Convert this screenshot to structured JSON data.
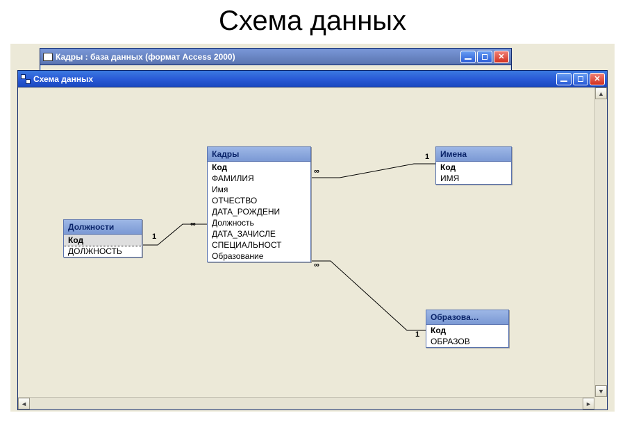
{
  "slide": {
    "title": "Схема данных"
  },
  "windows": {
    "database": {
      "title": "Кадры : база данных (формат Access 2000)"
    },
    "relationships": {
      "title": "Схема данных"
    }
  },
  "tables": {
    "dolzhnosti": {
      "title": "Должности",
      "fields": [
        "Код",
        "ДОЛЖНОСТЬ"
      ],
      "pk_index": 0,
      "selected_index": 0
    },
    "kadry": {
      "title": "Кадры",
      "fields": [
        "Код",
        "ФАМИЛИЯ",
        "Имя",
        "ОТЧЕСТВО",
        "ДАТА_РОЖДЕНИ",
        "Должность",
        "ДАТА_ЗАЧИСЛЕ",
        "СПЕЦИАЛЬНОСТ",
        "Образование"
      ],
      "pk_index": 0
    },
    "imena": {
      "title": "Имена",
      "fields": [
        "Код",
        "ИМЯ"
      ],
      "pk_index": 0
    },
    "obrazova": {
      "title": "Образова…",
      "fields": [
        "Код",
        "ОБРАЗОВ"
      ],
      "pk_index": 0
    }
  },
  "relations": {
    "r1": {
      "left_label": "1",
      "right_label": "∞"
    },
    "r2": {
      "left_label": "∞",
      "right_label": "1"
    },
    "r3": {
      "left_label": "∞",
      "right_label": "1"
    }
  },
  "scroll": {
    "up": "▲",
    "down": "▼",
    "left": "◄",
    "right": "►"
  }
}
